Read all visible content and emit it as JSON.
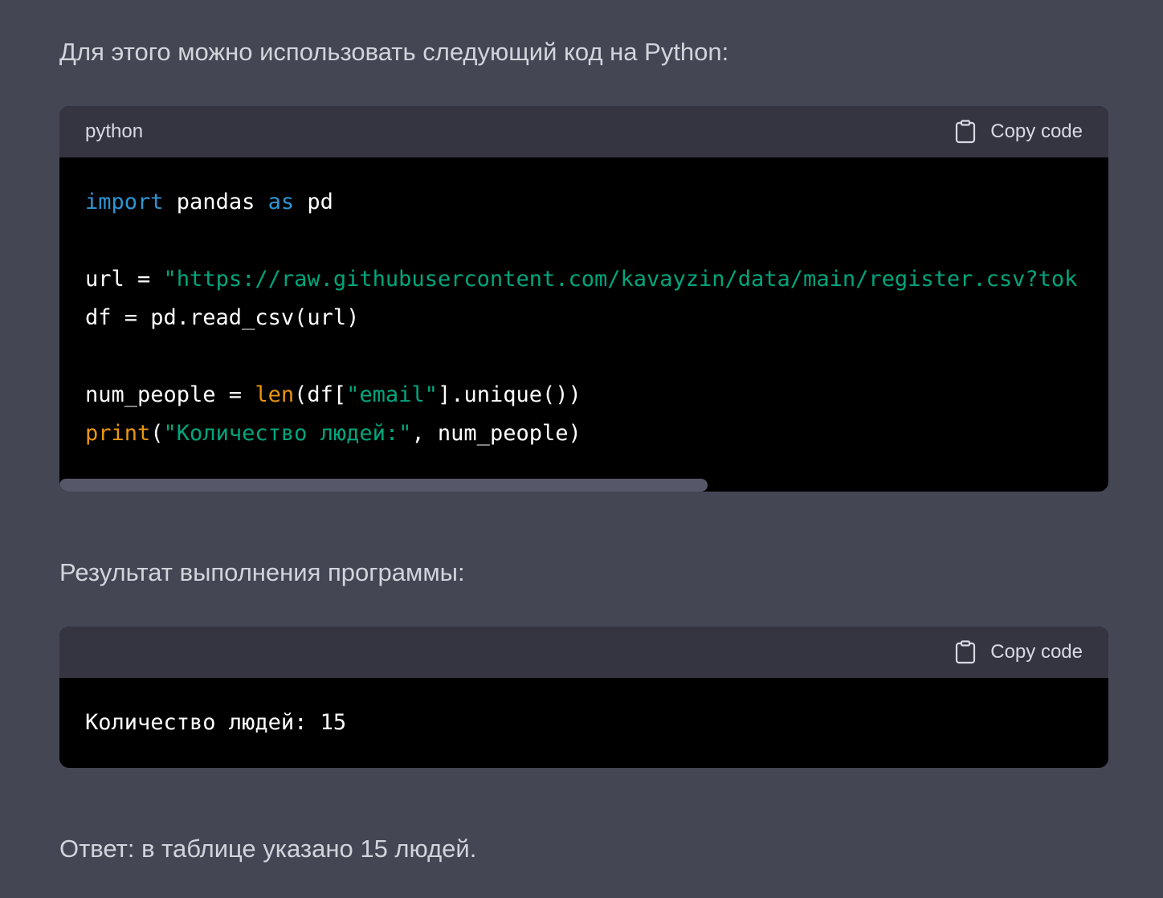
{
  "paragraphs": {
    "intro": "Для этого можно использовать следующий код на Python:",
    "result_label": "Результат выполнения программы:",
    "answer": "Ответ: в таблице указано 15 людей."
  },
  "code_block_1": {
    "language": "python",
    "copy_label": "Copy code",
    "icon": "clipboard-icon",
    "line1": {
      "kw1": "import",
      "t1": " pandas ",
      "kw2": "as",
      "t2": " pd"
    },
    "line2": {
      "t1": "url = ",
      "str1": "\"https://raw.githubusercontent.com/kavayzin/data/main/register.csv?tok"
    },
    "line3": {
      "t1": "df = pd.read_csv(url)"
    },
    "line4": {
      "t1": "num_people = ",
      "fn1": "len",
      "t2": "(df[",
      "str1": "\"email\"",
      "t3": "].unique())"
    },
    "line5": {
      "fn1": "print",
      "t1": "(",
      "str1": "\"Количество людей:\"",
      "t2": ", num_people)"
    }
  },
  "code_block_2": {
    "language": "",
    "copy_label": "Copy code",
    "icon": "clipboard-icon",
    "output": "Количество людей: 15"
  },
  "colors": {
    "page_bg": "#444654",
    "code_header_bg": "#343541",
    "code_bg": "#000000",
    "keyword": "#2e95d3",
    "string": "#00a67d",
    "builtin": "#e9950c",
    "scrollbar": "#565869"
  }
}
